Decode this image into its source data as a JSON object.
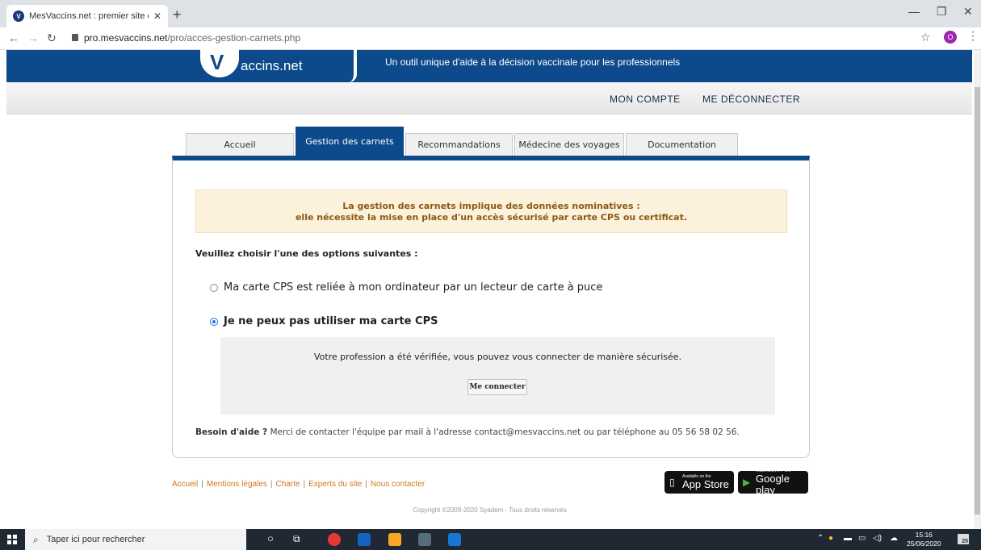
{
  "browser": {
    "tab_title": "MesVaccins.net : premier site de",
    "tab_close": "✕",
    "new_tab": "+",
    "url_host": "pro.mesvaccins.net",
    "url_path": "/pro/acces-gestion-carnets.php",
    "profile_initial": "O",
    "minimize": "—",
    "maximize": "❐",
    "close": "✕"
  },
  "header": {
    "logo_text": "accins.net",
    "tagline": "Un outil unique d'aide à la décision vaccinale pour les professionnels"
  },
  "topnav": {
    "account": "MON COMPTE",
    "logout": "ME DÉCONNECTER"
  },
  "tabs": [
    {
      "label": "Accueil",
      "active": false
    },
    {
      "label": "Gestion des carnets",
      "active": true
    },
    {
      "label": "Recommandations",
      "active": false
    },
    {
      "label": "Médecine des voyages",
      "active": false
    },
    {
      "label": "Documentation",
      "active": false
    }
  ],
  "main": {
    "warning_line1": "La gestion des carnets implique des données nominatives :",
    "warning_line2": "elle nécessite la mise en place d'un accès sécurisé par carte CPS ou certificat.",
    "question": "Veuillez choisir l'une des options suivantes :",
    "option1": "Ma carte CPS est reliée à mon ordinateur par un lecteur de carte à puce",
    "option2": "Je ne peux pas utiliser ma carte CPS",
    "selected_option": 2,
    "verified_text": "Votre profession a été vérifiée, vous pouvez vous connecter de manière sécurisée.",
    "connect_button": "Me connecter",
    "help_bold": "Besoin d'aide ?",
    "help_text": "Merci de contacter l'équipe par mail à l'adresse contact@mesvaccins.net ou par téléphone au 05 56 58 02 56."
  },
  "footer": {
    "links": [
      "Accueil",
      "Mentions légales",
      "Charte",
      "Experts du site",
      "Nous contacter"
    ],
    "appstore_small": "Available on the",
    "appstore_big": "App Store",
    "googleplay_small": "ANDROID APP ON",
    "googleplay_big": "Google play",
    "copyright": "Copyright ©2009-2020 Syadem - Tous droits réservés"
  },
  "taskbar": {
    "search_placeholder": "Taper ici pour rechercher",
    "time": "15:16",
    "date": "25/06/2020",
    "notification_count": "20"
  },
  "colors": {
    "brand_blue": "#0d4a8c",
    "warning_bg": "#fcf2dc",
    "footer_link": "#d0781e"
  }
}
